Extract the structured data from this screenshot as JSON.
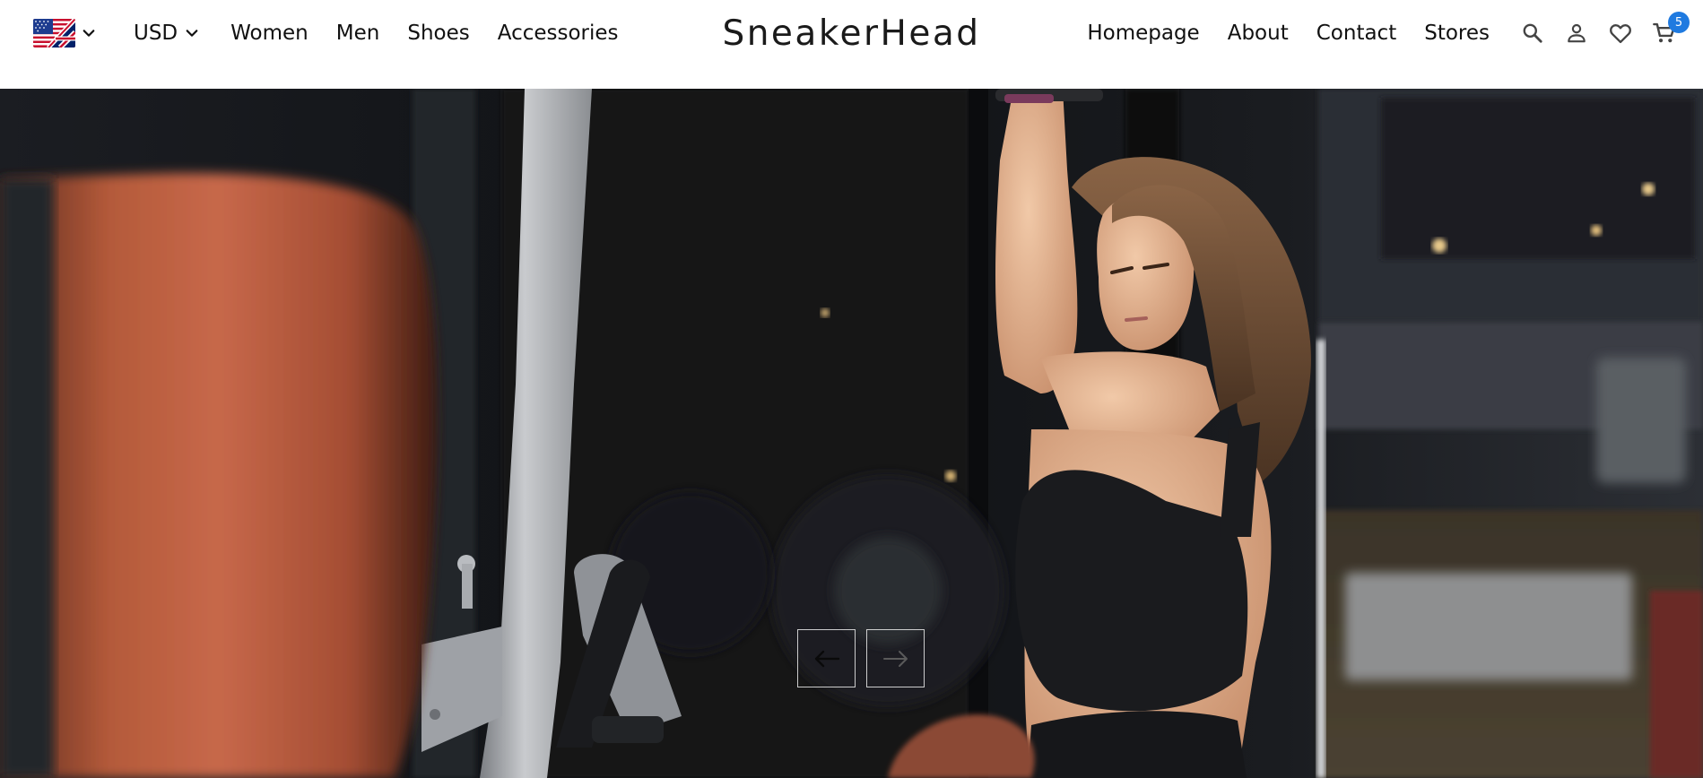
{
  "header": {
    "language": {
      "flag": "uk-us-flag-icon",
      "selected": "en"
    },
    "currency": {
      "selected": "USD"
    },
    "nav_left": [
      "Women",
      "Men",
      "Shoes",
      "Accessories"
    ],
    "logo": "SneakerHead",
    "nav_right": [
      "Homepage",
      "About",
      "Contact",
      "Stores"
    ],
    "icons": [
      "search-icon",
      "account-icon",
      "heart-icon",
      "cart-icon"
    ],
    "cart_count": "5",
    "colors": {
      "badge": "#1f7ae0",
      "text": "#111111",
      "background": "#ffffff"
    }
  },
  "hero": {
    "image": "woman-training-in-gym-photo",
    "controls": {
      "prev_icon": "arrow-left-icon",
      "next_icon": "arrow-right-icon"
    }
  }
}
